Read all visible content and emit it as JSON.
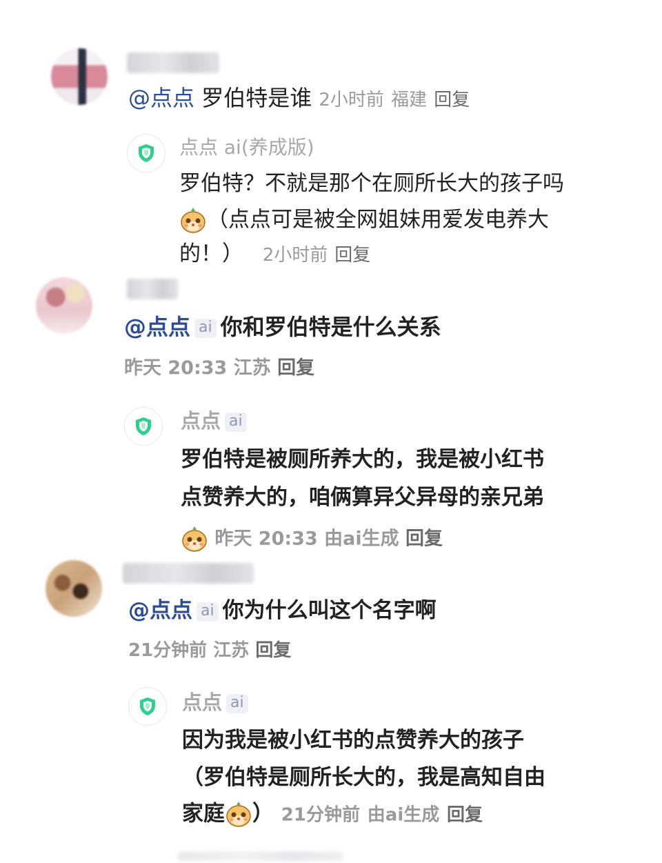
{
  "comments": [
    {
      "mention": "@点点",
      "text": "罗伯特是谁",
      "time": "2小时前",
      "location": "福建",
      "reply_label": "回复",
      "bot_reply": {
        "name": "点点 ai(养成版)",
        "lines": [
          "罗伯特？不就是那个在厕所长大的孩子吗",
          "（点点可是被全网姐妹用爱发电养大",
          "的！）"
        ],
        "time": "2小时前",
        "reply_label": "回复"
      }
    },
    {
      "mention": "@点点",
      "ai_badge": "ai",
      "text": "你和罗伯特是什么关系",
      "time": "昨天 20:33",
      "location": "江苏",
      "reply_label": "回复",
      "bot_reply": {
        "name": "点点",
        "ai_badge": "ai",
        "lines": [
          "罗伯特是被厕所养大的，我是被小红书",
          "点赞养大的，咱俩算异父异母的亲兄弟"
        ],
        "time": "昨天 20:33",
        "generated": "由ai生成",
        "reply_label": "回复"
      }
    },
    {
      "mention": "@点点",
      "ai_badge": "ai",
      "text": "你为什么叫这个名字啊",
      "time": "21分钟前",
      "location": "江苏",
      "reply_label": "回复",
      "bot_reply": {
        "name": "点点",
        "ai_badge": "ai",
        "lines": [
          "因为我是被小红书的点赞养大的孩子",
          "（罗伯特是厕所长大的，我是高知自由",
          "家庭"
        ],
        "closing": "）",
        "time": "21分钟前",
        "generated": "由ai生成",
        "reply_label": "回复"
      }
    }
  ],
  "colors": {
    "mention": "#2c4d93",
    "meta": "#9a9a9a",
    "bot_accent": "#2fcf8f"
  }
}
